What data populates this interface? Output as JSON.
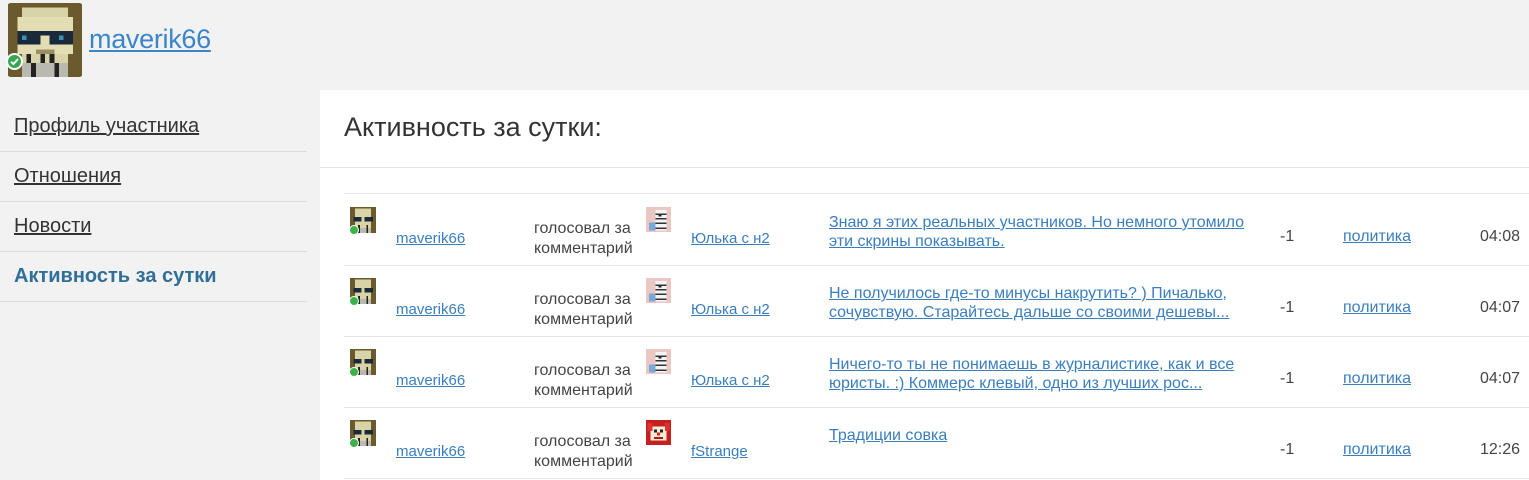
{
  "profile": {
    "username": "maverik66"
  },
  "sidebar": {
    "items": [
      {
        "label": "Профиль участника",
        "active": false
      },
      {
        "label": "Отношения",
        "active": false
      },
      {
        "label": "Новости",
        "active": false
      },
      {
        "label": "Активность за сутки",
        "active": true
      }
    ]
  },
  "main": {
    "title": "Активность за сутки:",
    "rows": [
      {
        "user": "maverik66",
        "action": "голосовал за комментарий",
        "target": "Юлька с н2",
        "target_avatar": "zebra",
        "comment": "Знаю я этих реальных участников. Но немного утомило эти скрины показывать.",
        "score": "-1",
        "category": "политика",
        "time": "04:08"
      },
      {
        "user": "maverik66",
        "action": "голосовал за комментарий",
        "target": "Юлька с н2",
        "target_avatar": "zebra",
        "comment": "Не получилось где-то минусы накрутить? ) Пичалько, сочувствую. Старайтесь дальше со своими дешевы...",
        "score": "-1",
        "category": "политика",
        "time": "04:07"
      },
      {
        "user": "maverik66",
        "action": "голосовал за комментарий",
        "target": "Юлька с н2",
        "target_avatar": "zebra",
        "comment": "Ничего-то ты не понимаешь в журналистике, как и все юристы. :) Коммерс клевый, одно из лучших рос...",
        "score": "-1",
        "category": "политика",
        "time": "04:07"
      },
      {
        "user": "maverik66",
        "action": "голосовал за комментарий",
        "target": "fStrange",
        "target_avatar": "clown",
        "comment": "Традиции совка",
        "score": "-1",
        "category": "политика",
        "time": "12:26"
      }
    ]
  },
  "colors": {
    "link": "#3a7ec0",
    "online": "#3bb34a",
    "active_nav": "#2f6f98"
  }
}
